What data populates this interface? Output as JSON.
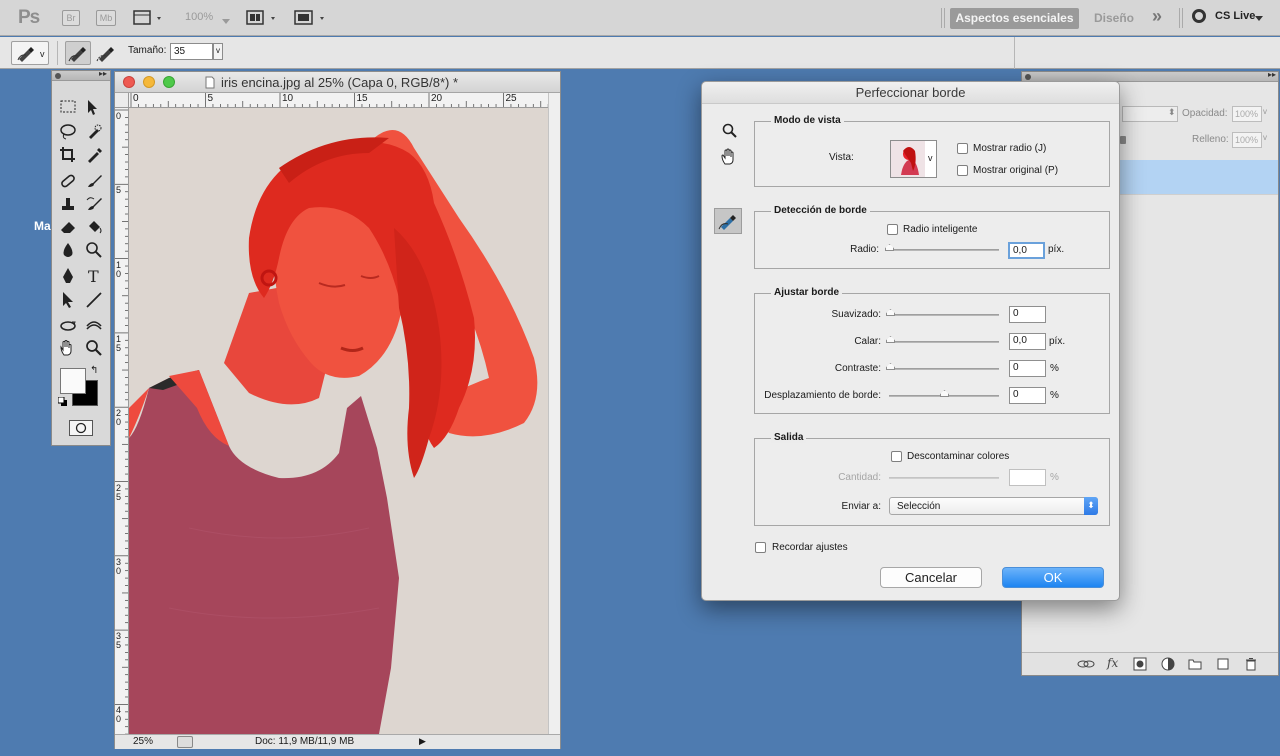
{
  "appbar": {
    "logo": "Ps",
    "bridge": "Br",
    "minibridge": "Mb",
    "zoom": "100%",
    "workspace_active": "Aspectos esenciales",
    "workspace_design": "Diseño",
    "more": "»",
    "cs_live": "CS Live"
  },
  "options": {
    "size_label": "Tamaño:",
    "size_value": "35"
  },
  "toolbox": {
    "icons": [
      "marquee-icon",
      "move-icon",
      "lasso-icon",
      "quick-selection-icon",
      "crop-icon",
      "eyedropper-icon",
      "healing-brush-icon",
      "brush-icon",
      "clone-stamp-icon",
      "history-brush-icon",
      "eraser-icon",
      "paint-bucket-icon",
      "blur-icon",
      "dodge-icon",
      "pen-icon",
      "type-icon",
      "path-selection-icon",
      "line-icon",
      "3d-rotate-icon",
      "3d-orbit-icon",
      "hand-icon",
      "zoom-icon"
    ]
  },
  "document": {
    "title": "iris encina.jpg al 25% (Capa 0, RGB/8*) *",
    "ruler_h": [
      "0",
      "5",
      "10",
      "15",
      "20",
      "25"
    ],
    "ruler_v": [
      "0",
      "5",
      "1\n0",
      "1\n5",
      "2\n0",
      "2\n5",
      "3\n0",
      "3\n5",
      "4\n0"
    ],
    "zoom": "25%",
    "doc_info": "Doc: 11,9 MB/11,9 MB"
  },
  "side_label": "Ma",
  "layers": {
    "opacity_label": "Opacidad:",
    "opacity_value": "100%",
    "fill_label": "Relleno:",
    "fill_value": "100%"
  },
  "dialog": {
    "title": "Perfeccionar borde",
    "view_mode": {
      "title": "Modo de vista",
      "view_label": "Vista:",
      "show_radius": "Mostrar radio (J)",
      "show_original": "Mostrar original (P)"
    },
    "edge_detection": {
      "title": "Detección de borde",
      "smart_radius": "Radio inteligente",
      "radius_label": "Radio:",
      "radius_value": "0,0",
      "radius_unit": "píx."
    },
    "adjust_edge": {
      "title": "Ajustar borde",
      "smooth_label": "Suavizado:",
      "smooth_value": "0",
      "feather_label": "Calar:",
      "feather_value": "0,0",
      "feather_unit": "píx.",
      "contrast_label": "Contraste:",
      "contrast_value": "0",
      "contrast_unit": "%",
      "shift_label": "Desplazamiento de borde:",
      "shift_value": "0",
      "shift_unit": "%"
    },
    "output": {
      "title": "Salida",
      "decontaminate": "Descontaminar colores",
      "amount_label": "Cantidad:",
      "amount_unit": "%",
      "send_label": "Enviar a:",
      "send_value": "Selección"
    },
    "remember": "Recordar ajustes",
    "cancel": "Cancelar",
    "ok": "OK"
  }
}
